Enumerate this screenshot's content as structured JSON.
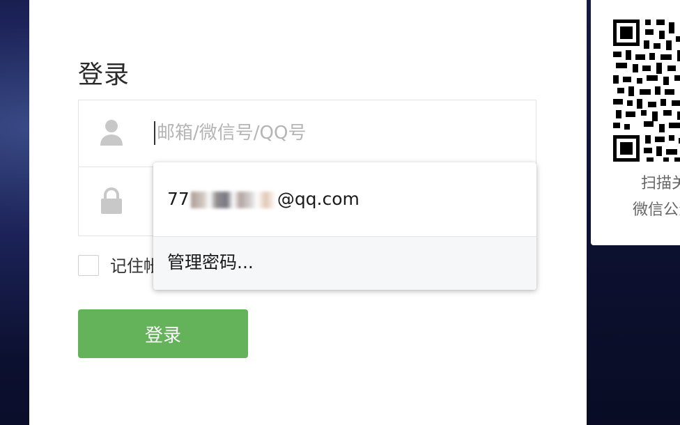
{
  "login": {
    "title": "登录",
    "username_placeholder": "邮箱/微信号/QQ号",
    "password_placeholder": "",
    "remember_label": "记住帐号",
    "submit_label": "登录"
  },
  "autocomplete": {
    "account_prefix": "77",
    "account_suffix": "@qq.com",
    "manage_label": "管理密码..."
  },
  "qr": {
    "line1": "扫描关注",
    "line2": "微信公众号"
  },
  "colors": {
    "submit_green": "#64b35a",
    "panel_white": "#ffffff",
    "background_navy": "#0c1030"
  },
  "icons": {
    "username": "user-icon",
    "password": "lock-icon"
  }
}
